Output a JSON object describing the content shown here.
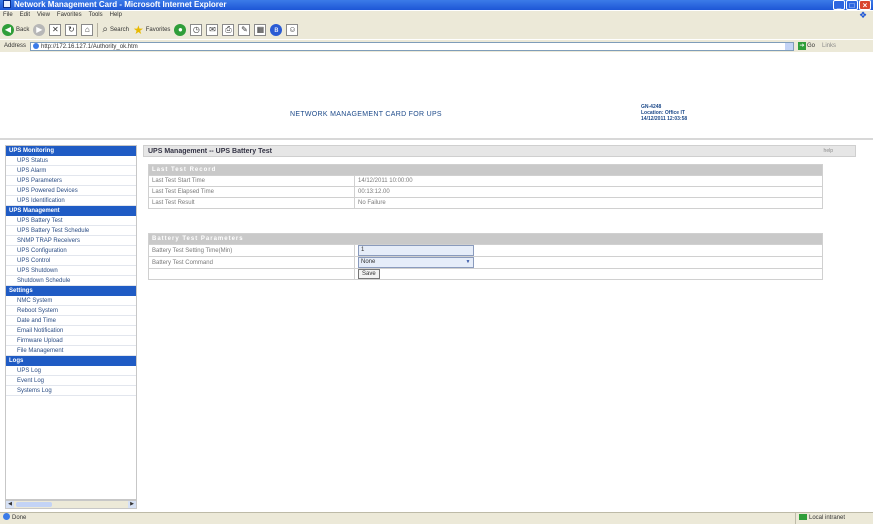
{
  "window": {
    "title": "Network Management Card - Microsoft Internet Explorer",
    "minimize": "_",
    "maximize": "□",
    "close": "×"
  },
  "menu": [
    "File",
    "Edit",
    "View",
    "Favorites",
    "Tools",
    "Help"
  ],
  "toolbar": {
    "back_label": "Back",
    "search_label": "Search",
    "favorites_label": "Favorites"
  },
  "address": {
    "label": "Address",
    "url": "http://172.16.127.1/Authority_ok.htm",
    "go_label": "Go",
    "links_label": "Links"
  },
  "header": {
    "title": "NETWORK MANAGEMENT CARD FOR UPS",
    "info_line1": "GN-4248",
    "info_line2": "Location: Office IT",
    "info_line3": "14/12/2011 12:03:58"
  },
  "sidebar": [
    {
      "heading": "UPS Monitoring",
      "items": [
        "UPS Status",
        "UPS Alarm",
        "UPS Parameters",
        "UPS Powered Devices",
        "UPS Identification"
      ]
    },
    {
      "heading": "UPS Management",
      "items": [
        "UPS Battery Test",
        "UPS Battery Test Schedule",
        "SNMP TRAP Receivers",
        "UPS Configuration",
        "UPS Control",
        "UPS Shutdown",
        "Shutdown Schedule"
      ]
    },
    {
      "heading": "Settings",
      "items": [
        "NMC System",
        "Reboot System",
        "Date and Time",
        "Email Notification",
        "Firmware Upload",
        "File Management"
      ]
    },
    {
      "heading": "Logs",
      "items": [
        "UPS Log",
        "Event Log",
        "Systems Log"
      ]
    }
  ],
  "main": {
    "title": "UPS Management -- UPS Battery Test",
    "help": "help",
    "last_test": {
      "section": "Last Test Record",
      "rows": [
        {
          "label": "Last Test Start Time",
          "value": "14/12/2011 10:00:00"
        },
        {
          "label": "Last Test Elapsed Time",
          "value": "00:13:12.00"
        },
        {
          "label": "Last Test Result",
          "value": "No Failure"
        }
      ]
    },
    "params": {
      "section": "Battery Test Parameters",
      "setting_time_label": "Battery Test Setting Time(Min)",
      "setting_time_value": "1",
      "command_label": "Battery Test Command",
      "command_value": "None",
      "save_label": "Save"
    }
  },
  "status": {
    "left": "Done",
    "zone": "Local intranet"
  }
}
